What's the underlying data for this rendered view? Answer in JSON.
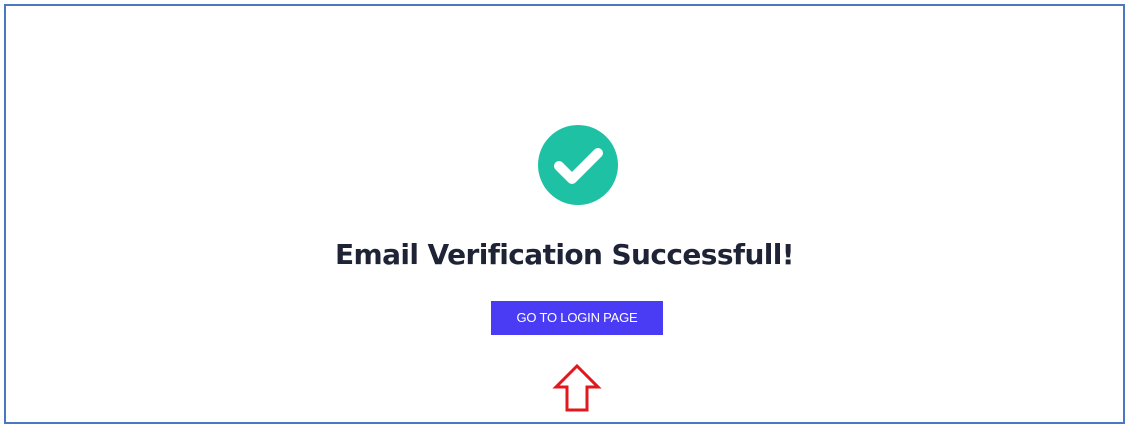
{
  "page": {
    "title": "Email Verification Successfull!",
    "button_label": "GO TO LOGIN PAGE",
    "status_icon": "check-circle-icon",
    "annotation_icon": "up-arrow-icon"
  },
  "colors": {
    "success": "#1fc1a5",
    "button": "#4a3cf5",
    "title": "#1e2436",
    "annotation": "#e0191f",
    "border": "#4a78c2"
  }
}
